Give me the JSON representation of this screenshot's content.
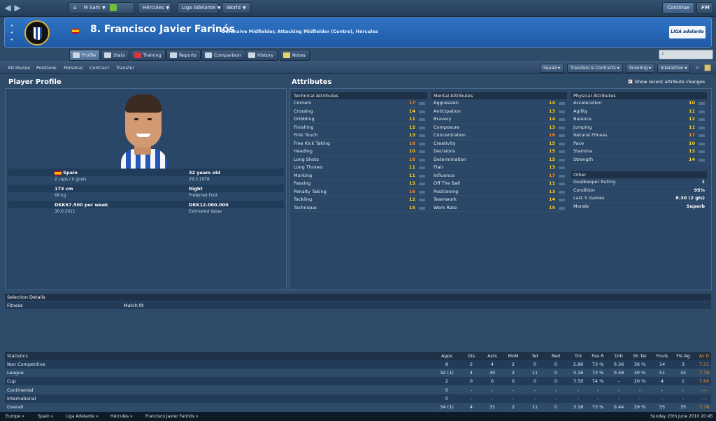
{
  "topbar": {
    "manager": "M Sahi",
    "club": "Hércules",
    "league": "Liga Adelante",
    "world": "World",
    "continue": "Continue",
    "fm": "FM"
  },
  "player": {
    "number_name": "8. Francisco Javier Farinós",
    "positions": "Defensive Midfielder, Attacking Midfielder (Centre), Hércules",
    "league_logo": "LIGA adelante"
  },
  "tabs": [
    {
      "label": "Profile",
      "icon": "profile-icon"
    },
    {
      "label": "Stats",
      "icon": "stats-icon"
    },
    {
      "label": "Training",
      "icon": "training-icon"
    },
    {
      "label": "Reports",
      "icon": "reports-icon"
    },
    {
      "label": "Comparison",
      "icon": "comparison-icon"
    },
    {
      "label": "History",
      "icon": "history-icon"
    },
    {
      "label": "Notes",
      "icon": "notes-icon"
    }
  ],
  "subnav": [
    "Attributes",
    "Positions",
    "Personal",
    "Contract",
    "Transfer"
  ],
  "dropdowns": [
    "Squad",
    "Transfers & Contracts",
    "Scouting",
    "Interaction"
  ],
  "profile": {
    "title": "Player Profile",
    "nation": "Spain",
    "caps": "2 caps / 0 goals",
    "age": "32 years old",
    "dob": "29.3.1978",
    "height": "173 cm",
    "weight": "68 kg",
    "foot": "Right",
    "foot_label": "Preferred Foot",
    "wage": "DKK67.500 per week",
    "contract_end": "30.6.2011",
    "value": "DKK12.000.000",
    "value_label": "Estimated Value"
  },
  "attributes": {
    "title": "Attributes",
    "show_changes": "Show recent attribute changes",
    "technical_title": "Technical Attributes",
    "technical": [
      [
        "Corners",
        "17"
      ],
      [
        "Crossing",
        "14"
      ],
      [
        "Dribbling",
        "11"
      ],
      [
        "Finishing",
        "12"
      ],
      [
        "First Touch",
        "13"
      ],
      [
        "Free Kick Taking",
        "16"
      ],
      [
        "Heading",
        "10"
      ],
      [
        "Long Shots",
        "16"
      ],
      [
        "Long Throws",
        "11"
      ],
      [
        "Marking",
        "11"
      ],
      [
        "Passing",
        "15"
      ],
      [
        "Penalty Taking",
        "16"
      ],
      [
        "Tackling",
        "12"
      ],
      [
        "Technique",
        "15"
      ]
    ],
    "mental_title": "Mental Attributes",
    "mental": [
      [
        "Aggression",
        "14"
      ],
      [
        "Anticipation",
        "13"
      ],
      [
        "Bravery",
        "14"
      ],
      [
        "Composure",
        "13"
      ],
      [
        "Concentration",
        "16"
      ],
      [
        "Creativity",
        "15"
      ],
      [
        "Decisions",
        "15"
      ],
      [
        "Determination",
        "15"
      ],
      [
        "Flair",
        "13"
      ],
      [
        "Influence",
        "17"
      ],
      [
        "Off The Ball",
        "11"
      ],
      [
        "Positioning",
        "13"
      ],
      [
        "Teamwork",
        "14"
      ],
      [
        "Work Rate",
        "15"
      ]
    ],
    "physical_title": "Physical Attributes",
    "physical": [
      [
        "Acceleration",
        "10"
      ],
      [
        "Agility",
        "11"
      ],
      [
        "Balance",
        "12"
      ],
      [
        "Jumping",
        "11"
      ],
      [
        "Natural Fitness",
        "17"
      ],
      [
        "Pace",
        "10"
      ],
      [
        "Stamina",
        "13"
      ],
      [
        "Strength",
        "14"
      ]
    ],
    "other_title": "Other",
    "other": [
      [
        "Goalkeeper Rating",
        "1"
      ],
      [
        "Condition",
        "95%"
      ],
      [
        "Last 5 Games",
        "8.30 (2 gls)"
      ],
      [
        "Morale",
        "Superb"
      ]
    ]
  },
  "selection": {
    "title": "Selection Details",
    "fitness": "Fitness",
    "match_fit": "Match fit"
  },
  "statistics": {
    "headers": [
      "Statistics",
      "Apps",
      "Gls",
      "Asts",
      "MoM",
      "Yel",
      "Red",
      "Tck",
      "Pas R",
      "Drb",
      "Sh Tar",
      "Fouls",
      "Fls Ag",
      "Av R"
    ],
    "rows": [
      [
        "Non Competitive",
        "8",
        "2",
        "4",
        "2",
        "0",
        "0",
        "2.86",
        "73 %",
        "0.36",
        "36 %",
        "14",
        "3",
        "7.31"
      ],
      [
        "League",
        "32 (1)",
        "4",
        "30",
        "2",
        "11",
        "0",
        "3.16",
        "73 %",
        "0.48",
        "30 %",
        "51",
        "34",
        "7.79"
      ],
      [
        "Cup",
        "2",
        "0",
        "0",
        "0",
        "0",
        "0",
        "3.50",
        "74 %",
        "-",
        "20 %",
        "4",
        "1",
        "7.60"
      ],
      [
        "Continental",
        "0",
        "-",
        "-",
        "-",
        "-",
        "-",
        "-",
        "-",
        "-",
        "-",
        "-",
        "-",
        "----"
      ],
      [
        "International",
        "0",
        "-",
        "-",
        "-",
        "-",
        "-",
        "-",
        "-",
        "-",
        "-",
        "-",
        "-",
        "----"
      ],
      [
        "Overall",
        "34 (1)",
        "4",
        "31",
        "2",
        "11",
        "0",
        "3.18",
        "73 %",
        "0.44",
        "29 %",
        "55",
        "35",
        "7.78"
      ]
    ]
  },
  "footer": {
    "crumbs": [
      "Europe",
      "Spain",
      "Liga Adelante",
      "Hércules",
      "Francisco Javier Farinós"
    ],
    "date": "Sunday 20th June 2010 20:45"
  }
}
